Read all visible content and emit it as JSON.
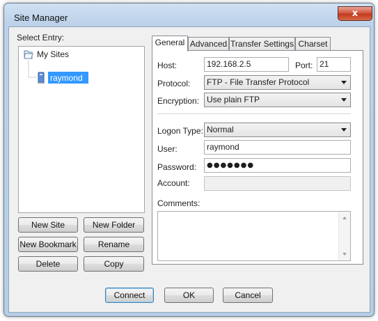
{
  "window": {
    "title": "Site Manager",
    "close_glyph": "x"
  },
  "select_entry_label": "Select Entry:",
  "tree": {
    "root": {
      "label": "My Sites",
      "icon": "folder-icon"
    },
    "children": [
      {
        "label": "raymond",
        "icon": "server-icon",
        "selected": true
      }
    ]
  },
  "left_buttons": {
    "new_site": "New Site",
    "new_folder": "New Folder",
    "new_bookmark": "New Bookmark",
    "rename": "Rename",
    "delete": "Delete",
    "copy": "Copy"
  },
  "tabs": [
    {
      "label": "General",
      "active": true
    },
    {
      "label": "Advanced",
      "active": false
    },
    {
      "label": "Transfer Settings",
      "active": false
    },
    {
      "label": "Charset",
      "active": false
    }
  ],
  "general": {
    "host_label": "Host:",
    "host_value": "192.168.2.5",
    "port_label": "Port:",
    "port_value": "21",
    "protocol_label": "Protocol:",
    "protocol_value": "FTP - File Transfer Protocol",
    "encryption_label": "Encryption:",
    "encryption_value": "Use plain FTP",
    "logon_type_label": "Logon Type:",
    "logon_type_value": "Normal",
    "user_label": "User:",
    "user_value": "raymond",
    "password_label": "Password:",
    "password_value": "●●●●●●●",
    "account_label": "Account:",
    "account_value": "",
    "comments_label": "Comments:",
    "comments_value": ""
  },
  "footer": {
    "connect": "Connect",
    "ok": "OK",
    "cancel": "Cancel"
  },
  "colors": {
    "frame": "#b6cde6",
    "close_button": "#c23a1f",
    "selection": "#3399ff"
  }
}
